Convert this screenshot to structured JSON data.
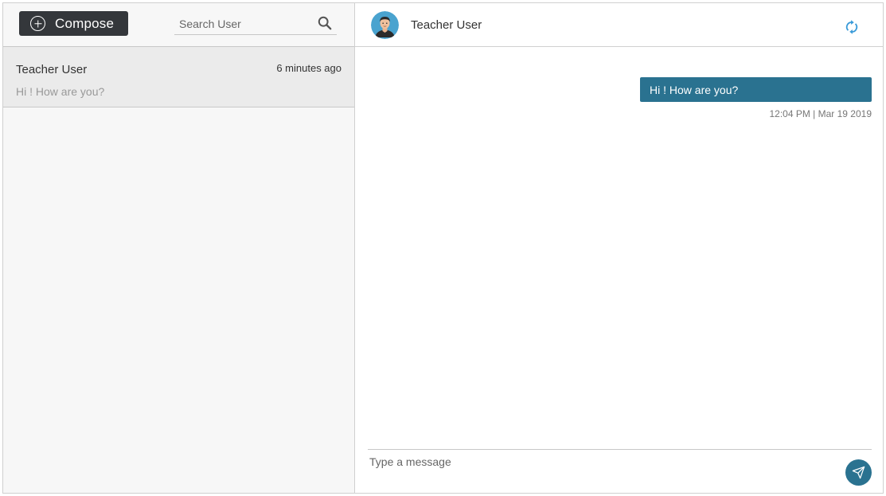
{
  "sidebar": {
    "compose_label": "Compose",
    "compose_icon": "plus-circle-icon",
    "search": {
      "placeholder": "Search User",
      "value": "",
      "icon": "search-icon"
    },
    "conversations": [
      {
        "name": "Teacher User",
        "time": "6 minutes ago",
        "preview": "Hi ! How are you?"
      }
    ]
  },
  "chat": {
    "title": "Teacher User",
    "avatar_icon": "user-avatar-icon",
    "refresh_icon": "refresh-icon",
    "messages": [
      {
        "text": "Hi ! How are you?",
        "timestamp": "12:04 PM | Mar 19 2019",
        "direction": "outgoing"
      }
    ],
    "composer": {
      "placeholder": "Type a message",
      "value": "",
      "send_icon": "send-icon"
    }
  },
  "colors": {
    "accent": "#2a7290",
    "compose_bg": "#34373b",
    "refresh": "#3a9bd9",
    "sidebar_bg": "#f7f7f7",
    "selected_bg": "#ebebeb"
  }
}
